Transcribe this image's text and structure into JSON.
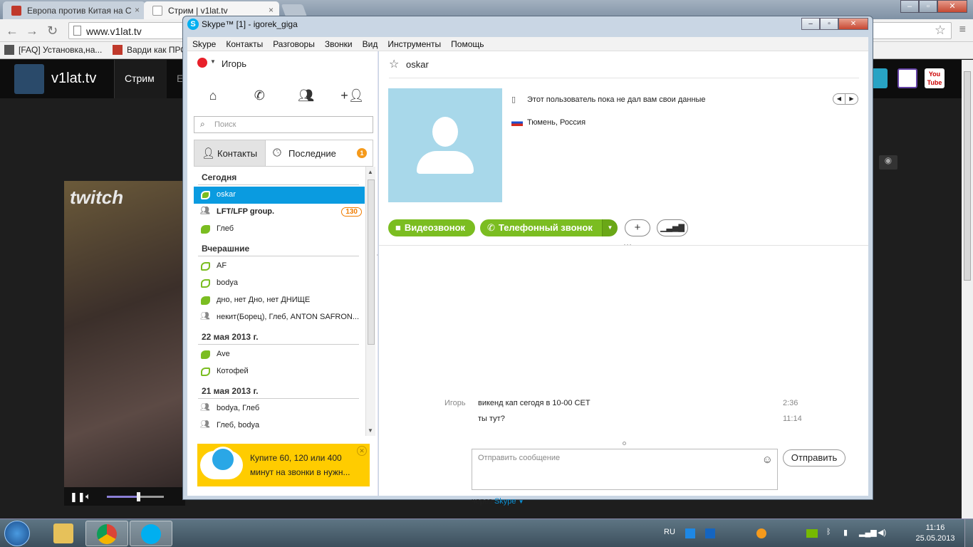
{
  "browser": {
    "tabs": [
      {
        "label": "Европа против Китая на С",
        "close": "×"
      },
      {
        "label": "Стрим | v1lat.tv",
        "close": "×"
      }
    ],
    "url": "www.v1lat.tv",
    "bookmarks": [
      "[FAQ] Установка,на...",
      "Варди как ПРО"
    ],
    "window_controls": {
      "min": "–",
      "max": "▫",
      "close": "✕"
    }
  },
  "site": {
    "name": "v1lat.tv",
    "active_tab": "Стрим",
    "next_tab_fragment": "Е",
    "video_watermark": "twitch",
    "social": [
      "twitch-icon",
      "youtube-icon"
    ],
    "youtube_label": "You Tube"
  },
  "skype": {
    "title": "Skype™ [1] - igorek_giga",
    "window_controls": {
      "min": "–",
      "max": "▫",
      "close": "✕"
    },
    "menu": [
      "Skype",
      "Контакты",
      "Разговоры",
      "Звонки",
      "Вид",
      "Инструменты",
      "Помощь"
    ],
    "user_name": "Игорь",
    "search_placeholder": "Поиск",
    "tab_contacts": "Контакты",
    "tab_recent": "Последние",
    "recent_badge": "1",
    "groups": [
      {
        "label": "Сегодня",
        "items": [
          {
            "name": "oskar",
            "selected": true,
            "kind": "online"
          },
          {
            "name": "LFT/LFP group.",
            "bold": true,
            "kind": "group",
            "count": "130"
          },
          {
            "name": "Глеб",
            "kind": "online"
          }
        ]
      },
      {
        "label": "Вчерашние",
        "items": [
          {
            "name": "AF",
            "kind": "away"
          },
          {
            "name": "bodya",
            "kind": "away"
          },
          {
            "name": "дно, нет Дно, нет ДНИЩЕ",
            "kind": "online"
          },
          {
            "name": "некит(Борец), Глеб, ANTON SAFRON...",
            "kind": "group"
          }
        ]
      },
      {
        "label": "22 мая 2013 г.",
        "items": [
          {
            "name": "Ave",
            "kind": "online"
          },
          {
            "name": "Котофей",
            "kind": "away"
          }
        ]
      },
      {
        "label": "21 мая 2013 г.",
        "items": [
          {
            "name": "bodya, Глеб",
            "kind": "group"
          },
          {
            "name": "Глеб, bodya",
            "kind": "group"
          }
        ]
      }
    ],
    "ad_text": "Купите 60, 120 или 400 минут на звонки в нужн...",
    "contact": {
      "name": "oskar",
      "mood": "Этот пользователь пока не дал вам свои данные",
      "location": "Тюмень, Россия"
    },
    "buttons": {
      "video_call": "Видеозвонок",
      "phone_call": "Телефонный звонок",
      "add": "+",
      "signal": "signal-icon"
    },
    "messages": [
      {
        "sender": "Игорь",
        "text": "викенд кап сегодя в 10-00 CET",
        "time": "2:36"
      },
      {
        "sender": "",
        "text": "ты тут?",
        "time": "11:14"
      }
    ],
    "composer_placeholder": "Отправить сообщение",
    "send_label": "Отправить",
    "via_prefix": "через",
    "via_service": "Skype"
  },
  "taskbar": {
    "lang": "RU",
    "clock_time": "11:16",
    "clock_date": "25.05.2013"
  },
  "colors": {
    "skype_blue": "#0a9be0",
    "skype_green": "#7bbd21",
    "badge_orange": "#f59a1b",
    "ad_yellow": "#ffcc00"
  }
}
